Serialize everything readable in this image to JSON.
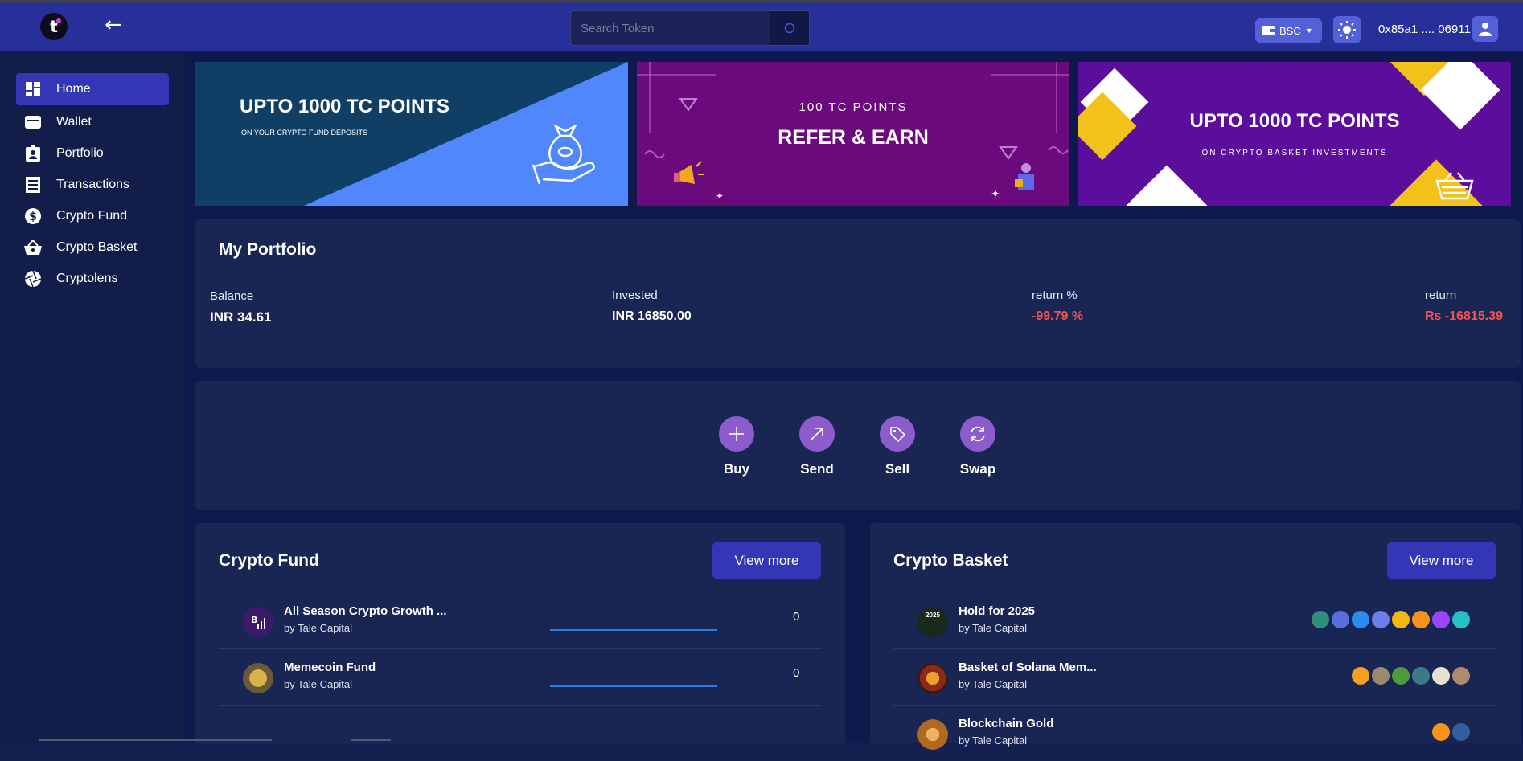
{
  "header": {
    "logo_letter": "t",
    "back_icon": "arrow-left-icon",
    "search_placeholder": "Search Token",
    "chain": "BSC",
    "wallet_address": "0x85a1 .... 06911"
  },
  "sidebar": {
    "items": [
      {
        "label": "Home",
        "icon": "dashboard-icon",
        "active": true
      },
      {
        "label": "Wallet",
        "icon": "wallet-icon"
      },
      {
        "label": "Portfolio",
        "icon": "portfolio-badge-icon"
      },
      {
        "label": "Transactions",
        "icon": "receipt-icon"
      },
      {
        "label": "Crypto Fund",
        "icon": "dollar-circle-icon"
      },
      {
        "label": "Crypto Basket",
        "icon": "basket-icon"
      },
      {
        "label": "Cryptolens",
        "icon": "aperture-icon"
      }
    ]
  },
  "banners": [
    {
      "title": "UPTO 1000 TC POINTS",
      "subtitle": "ON YOUR CRYPTO FUND DEPOSITS",
      "bg": "#0f3f65",
      "accent": "#5087fc"
    },
    {
      "top": "100 TC POINTS",
      "title": "REFER & EARN",
      "bg": "#6a0a7d"
    },
    {
      "title": "UPTO 1000 TC POINTS",
      "subtitle": "ON CRYPTO BASKET INVESTMENTS",
      "bg": "#5b0d9c",
      "accent": "#f2c21b"
    }
  ],
  "portfolio": {
    "title": "My Portfolio",
    "balance_label": "Balance",
    "balance_value": "INR 34.61",
    "invested_label": "Invested",
    "invested_value": "INR 16850.00",
    "return_pct_label": "return %",
    "return_pct_value": "-99.79 %",
    "return_label": "return",
    "return_value": "Rs -16815.39"
  },
  "actions": [
    {
      "label": "Buy",
      "icon": "plus-icon"
    },
    {
      "label": "Send",
      "icon": "arrow-up-right-icon"
    },
    {
      "label": "Sell",
      "icon": "tag-icon"
    },
    {
      "label": "Swap",
      "icon": "refresh-icon"
    }
  ],
  "crypto_fund": {
    "title": "Crypto Fund",
    "view_more": "View more",
    "rows": [
      {
        "name": "All Season Crypto Growth ...",
        "by": "by Tale Capital",
        "value": "0"
      },
      {
        "name": "Memecoin Fund",
        "by": "by Tale Capital",
        "value": "0"
      }
    ]
  },
  "crypto_basket": {
    "title": "Crypto Basket",
    "view_more": "View more",
    "rows": [
      {
        "name": "Hold for 2025",
        "by": "by Tale Capital",
        "avatar_text": "2025",
        "coins": [
          "#2f8f7a",
          "#5b6ee0",
          "#2a8cf0",
          "#6a7fe8",
          "#f0b90b",
          "#f7931a",
          "#9945ff",
          "#22c1c3"
        ]
      },
      {
        "name": "Basket of Solana Mem...",
        "by": "by Tale Capital",
        "coins": [
          "#f4a020",
          "#9a8a70",
          "#4f9a3a",
          "#3a7a8a",
          "#e8e0d0",
          "#b08a6a"
        ]
      },
      {
        "name": "Blockchain Gold",
        "by": "by Tale Capital",
        "coins": [
          "#f7931a",
          "#345d9d"
        ]
      }
    ]
  }
}
